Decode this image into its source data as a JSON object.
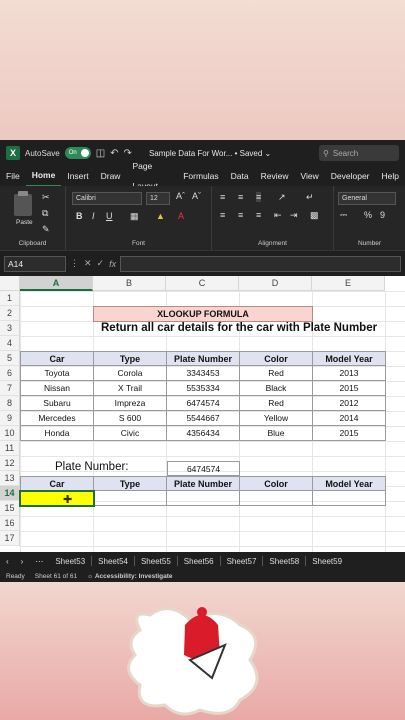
{
  "window": {
    "autosave_label": "AutoSave",
    "autosave_state": "On",
    "doc_title": "Sample Data For Wor... • Saved ⌄",
    "search_placeholder": "Search"
  },
  "menu": [
    "File",
    "Home",
    "Insert",
    "Draw",
    "Page Layout",
    "Formulas",
    "Data",
    "Review",
    "View",
    "Developer",
    "Help"
  ],
  "menu_active": "Home",
  "ribbon": {
    "clipboard_label": "Clipboard",
    "paste_label": "Paste",
    "font_name": "Calibri",
    "font_size": "12",
    "font_label": "Font",
    "alignment_label": "Alignment",
    "number_format": "General",
    "number_label": "Number"
  },
  "formula_bar": {
    "name_box": "A14",
    "fx": "fx"
  },
  "columns": [
    "A",
    "B",
    "C",
    "D",
    "E"
  ],
  "active_column": "A",
  "rows": [
    "1",
    "2",
    "3",
    "4",
    "5",
    "6",
    "7",
    "8",
    "9",
    "10",
    "11",
    "12",
    "13",
    "14",
    "15",
    "16",
    "17"
  ],
  "active_row": "14",
  "sheet": {
    "title": "XLOOKUP FORMULA",
    "subtitle": "Return all car details for the car with Plate Number",
    "headers": [
      "Car",
      "Type",
      "Plate Number",
      "Color",
      "Model Year"
    ],
    "table": [
      [
        "Toyota",
        "Corola",
        "3343453",
        "Red",
        "2013"
      ],
      [
        "Nissan",
        "X Trail",
        "5535334",
        "Black",
        "2015"
      ],
      [
        "Subaru",
        "Impreza",
        "6474574",
        "Red",
        "2012"
      ],
      [
        "Mercedes",
        "S 600",
        "5544667",
        "Yellow",
        "2014"
      ],
      [
        "Honda",
        "Civic",
        "4356434",
        "Blue",
        "2015"
      ]
    ],
    "plate_label": "Plate Number:",
    "plate_value": "6474574",
    "result_headers": [
      "Car",
      "Type",
      "Plate Number",
      "Color",
      "Model Year"
    ]
  },
  "sheet_tabs": [
    "Sheet53",
    "Sheet54",
    "Sheet55",
    "Sheet56",
    "Sheet57",
    "Sheet58",
    "Sheet59"
  ],
  "status": {
    "ready": "Ready",
    "sheet_info": "Sheet 61 of 61",
    "accessibility": "Accessibility: Investigate"
  },
  "colors": {
    "header_fill": "#dfe3f1",
    "title_fill": "#f9d5d0",
    "active_fill": "#ffff00",
    "accent": "#1d6f42"
  }
}
